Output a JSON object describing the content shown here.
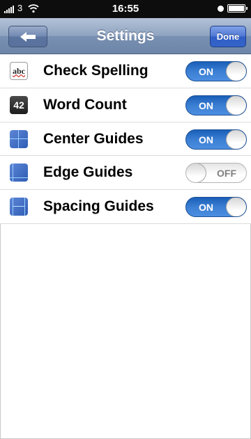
{
  "status_bar": {
    "carrier": "3",
    "time": "16:55"
  },
  "nav": {
    "title": "Settings",
    "back_icon": "back-arrow-icon",
    "done_label": "Done"
  },
  "settings": [
    {
      "label": "Check Spelling",
      "icon": "spellcheck-icon",
      "icon_text": "abc",
      "state": "ON",
      "on": true
    },
    {
      "label": "Word Count",
      "icon": "word-count-icon",
      "icon_text": "42",
      "state": "ON",
      "on": true
    },
    {
      "label": "Center Guides",
      "icon": "center-guides-icon",
      "state": "ON",
      "on": true
    },
    {
      "label": "Edge Guides",
      "icon": "edge-guides-icon",
      "state": "OFF",
      "on": false
    },
    {
      "label": "Spacing Guides",
      "icon": "spacing-guides-icon",
      "state": "ON",
      "on": true
    }
  ],
  "colors": {
    "toggle_on": "#3b7fd3",
    "nav_bar": "#8fa3c0",
    "done_button": "#3463c8"
  }
}
